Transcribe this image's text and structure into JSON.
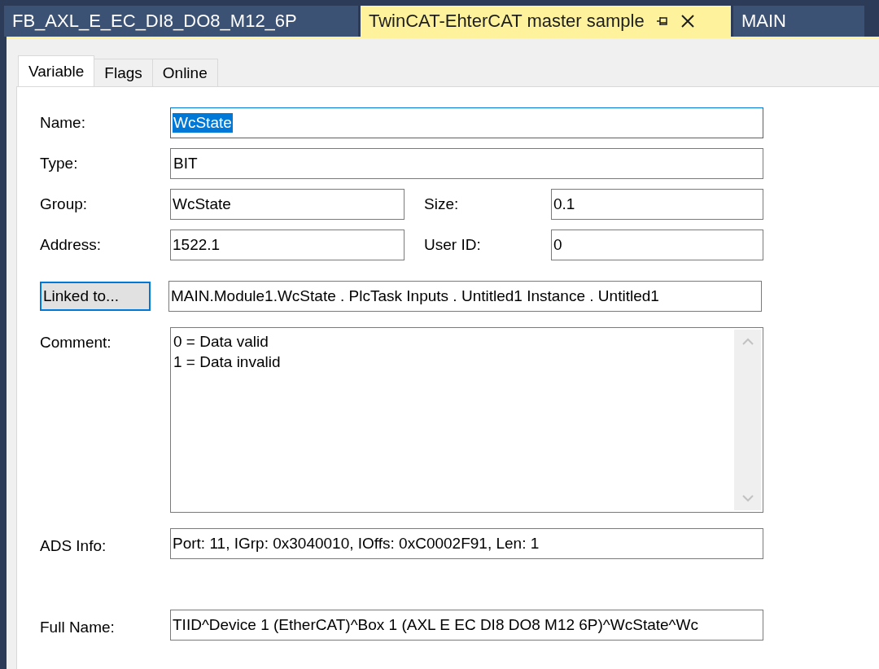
{
  "document_tabs": [
    {
      "label": "FB_AXL_E_EC_DI8_DO8_M12_6P",
      "selected": false
    },
    {
      "label": "TwinCAT-EhterCAT master sample",
      "selected": true
    },
    {
      "label": "MAIN",
      "selected": false
    }
  ],
  "tabs": [
    {
      "label": "Variable",
      "selected": true
    },
    {
      "label": "Flags",
      "selected": false
    },
    {
      "label": "Online",
      "selected": false
    }
  ],
  "rows": [
    {
      "kind": "field",
      "label": "Name:",
      "value": "WcState",
      "focused": true
    },
    {
      "kind": "field",
      "label": "Type:",
      "value": "BIT",
      "focused": false
    },
    {
      "kind": "pair",
      "label": "Group:",
      "value": "WcState",
      "label_2": "Size:",
      "value_2": "0.1"
    },
    {
      "kind": "pair",
      "label": "Address:",
      "value": "1522.1",
      "label_2": "User ID:",
      "value_2": "0"
    },
    {
      "kind": "button",
      "button": "Linked to...",
      "value": "MAIN.Module1.WcState . PlcTask Inputs . Untitled1 Instance . Untitled1",
      "focused": true
    },
    {
      "kind": "memo",
      "label": "Comment:",
      "lines": [
        "0 = Data valid",
        "1 = Data invalid"
      ]
    }
  ],
  "info_rows": [
    {
      "label": "ADS Info:",
      "value": "Port: 11, IGrp: 0x3040010, IOffs: 0xC0002F91, Len: 1"
    },
    {
      "label": "Full Name:",
      "value": "TIID^Device 1 (EtherCAT)^Box 1 (AXL E EC DI8 DO8 M12 6P)^WcState^Wc"
    }
  ]
}
